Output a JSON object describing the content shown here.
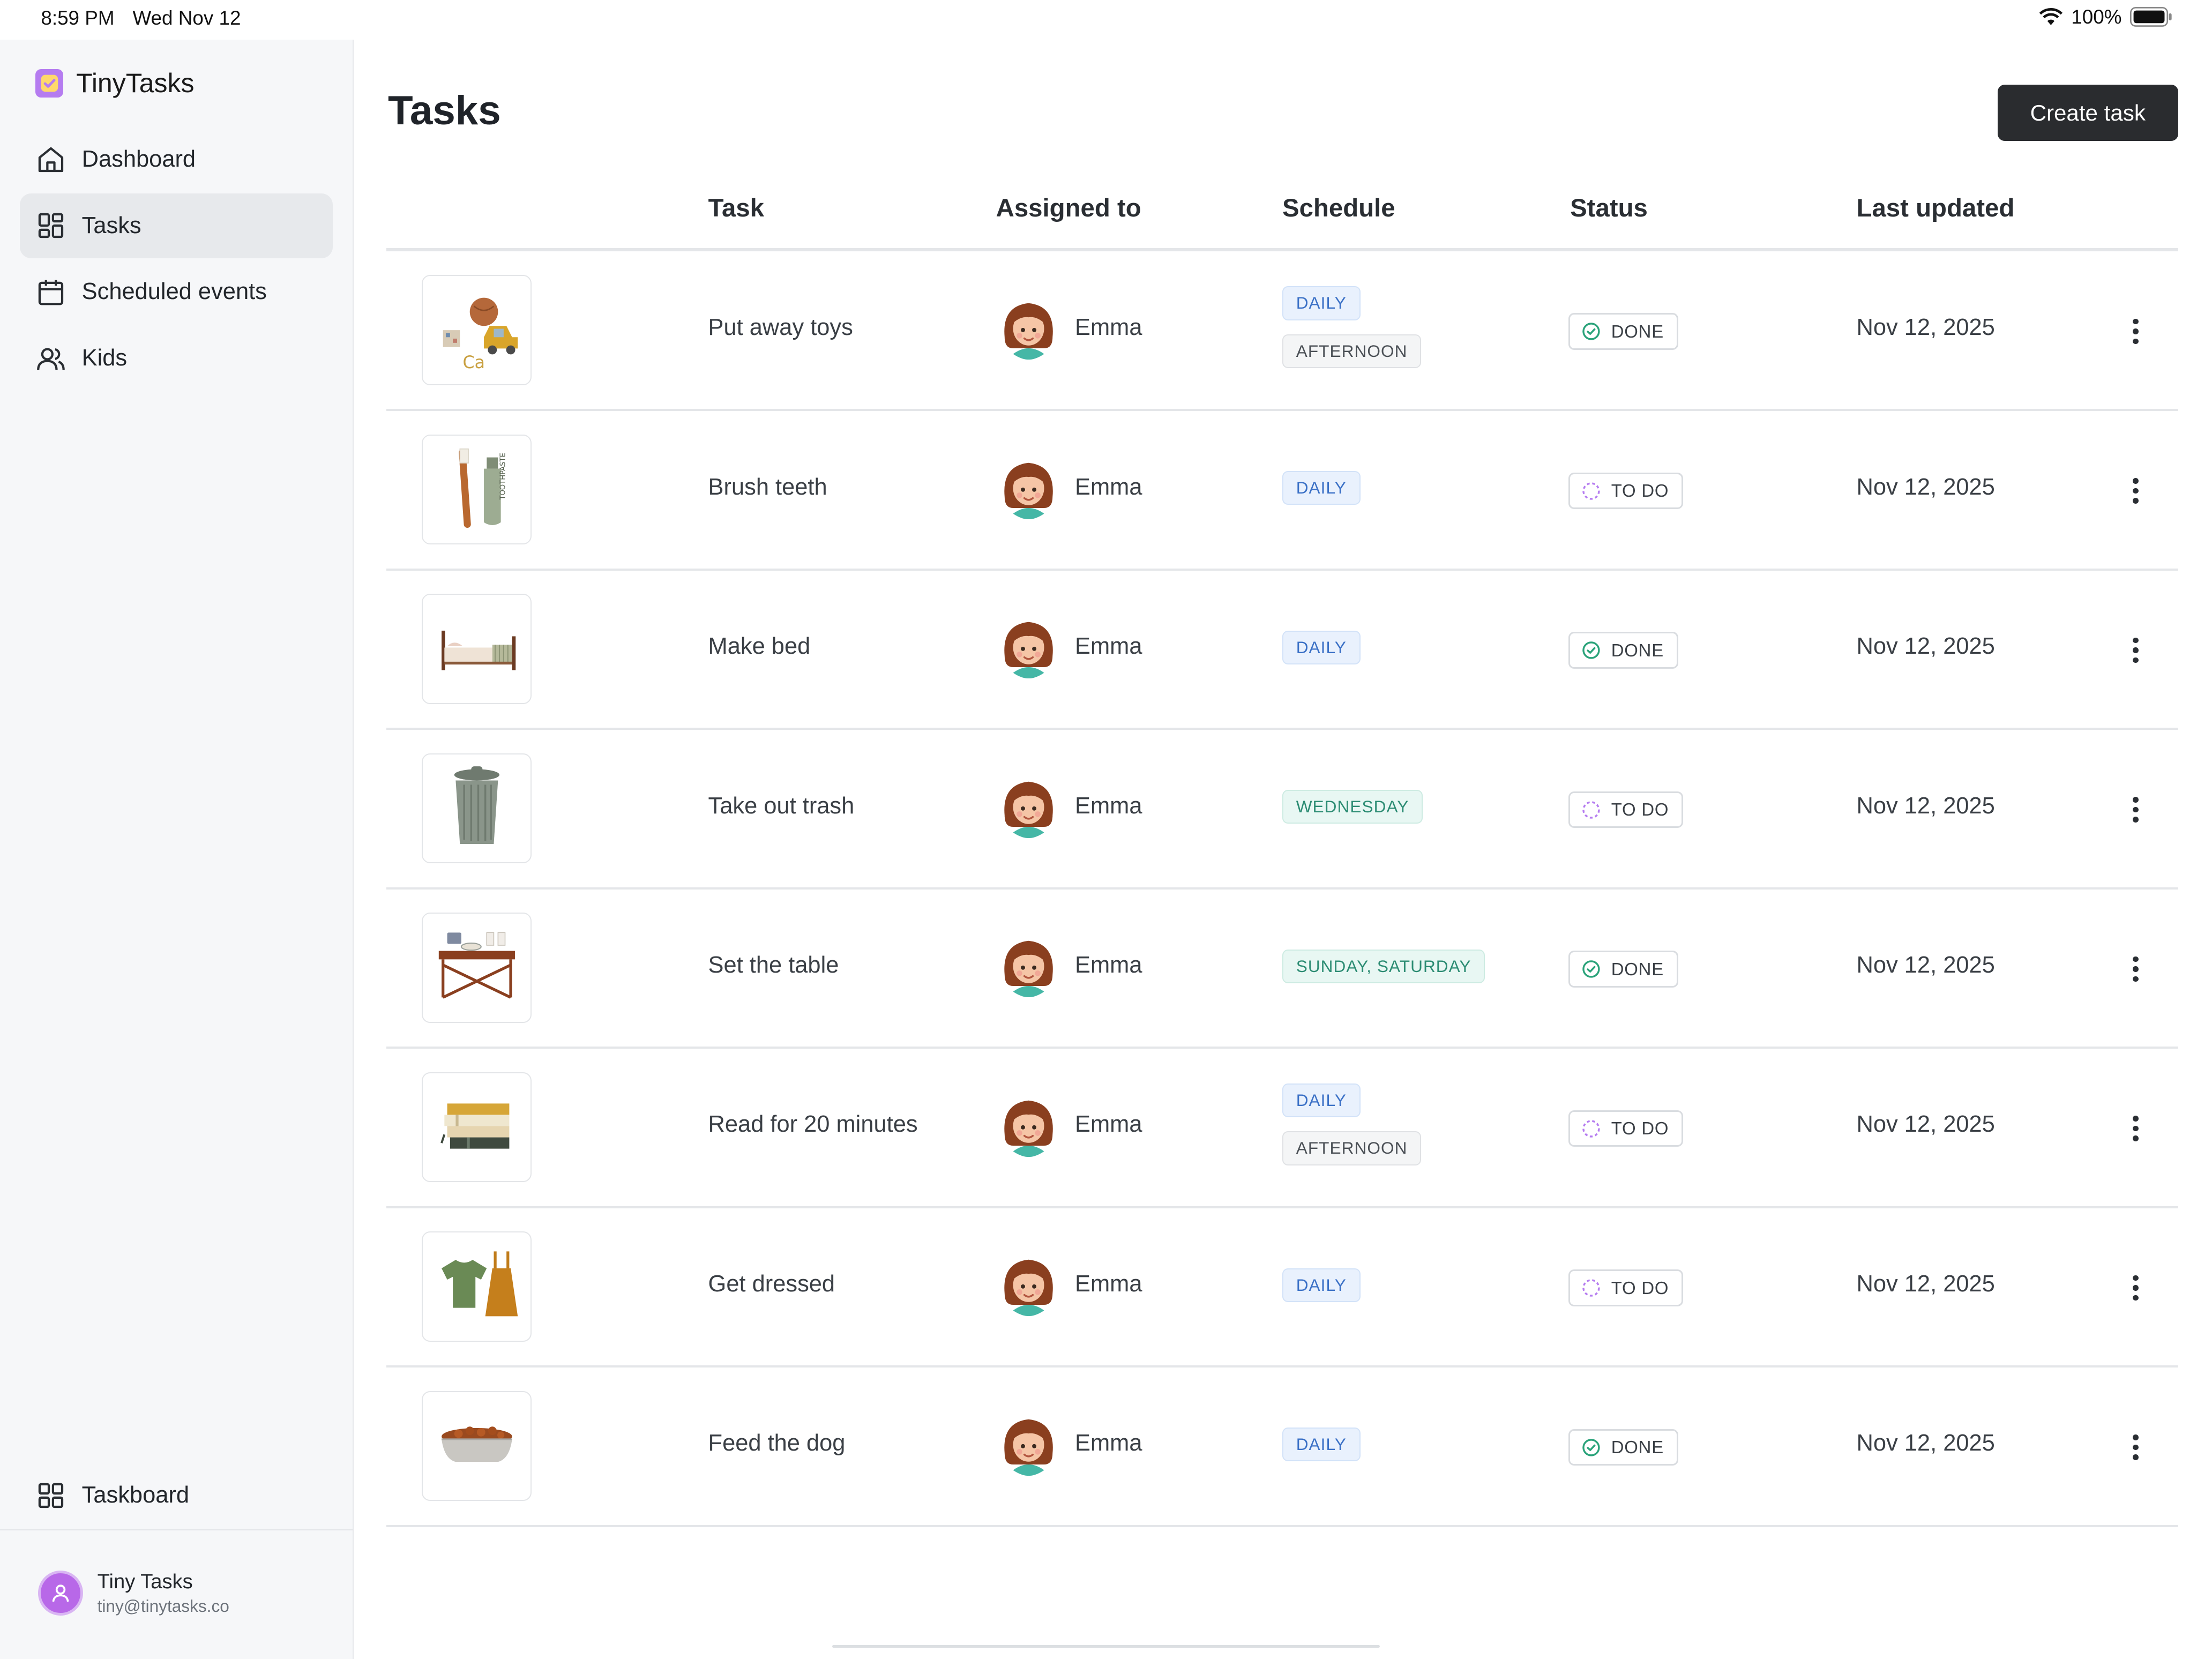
{
  "status_bar": {
    "time": "8:59 PM",
    "date": "Wed Nov 12",
    "battery": "100%"
  },
  "app": {
    "name": "TinyTasks"
  },
  "sidebar": {
    "items": [
      {
        "label": "Dashboard",
        "icon": "home-icon"
      },
      {
        "label": "Tasks",
        "icon": "grid-icon",
        "active": true
      },
      {
        "label": "Scheduled events",
        "icon": "calendar-icon"
      },
      {
        "label": "Kids",
        "icon": "users-icon"
      }
    ],
    "taskboard": "Taskboard",
    "user": {
      "name": "Tiny Tasks",
      "email": "tiny@tinytasks.co"
    }
  },
  "page": {
    "title": "Tasks",
    "create_button": "Create task"
  },
  "table": {
    "columns": [
      "Task",
      "Assigned to",
      "Schedule",
      "Status",
      "Last updated"
    ],
    "rows": [
      {
        "task": "Put away toys",
        "assignee": "Emma",
        "schedule": [
          "DAILY",
          "AFTERNOON"
        ],
        "status": "DONE",
        "updated": "Nov 12, 2025",
        "icon": "toys-icon"
      },
      {
        "task": "Brush teeth",
        "assignee": "Emma",
        "schedule": [
          "DAILY"
        ],
        "status": "TO DO",
        "updated": "Nov 12, 2025",
        "icon": "toothbrush-icon"
      },
      {
        "task": "Make bed",
        "assignee": "Emma",
        "schedule": [
          "DAILY"
        ],
        "status": "DONE",
        "updated": "Nov 12, 2025",
        "icon": "bed-icon"
      },
      {
        "task": "Take out trash",
        "assignee": "Emma",
        "schedule": [
          "WEDNESDAY"
        ],
        "status": "TO DO",
        "updated": "Nov 12, 2025",
        "icon": "trash-can-icon"
      },
      {
        "task": "Set the table",
        "assignee": "Emma",
        "schedule": [
          "SUNDAY, SATURDAY"
        ],
        "status": "DONE",
        "updated": "Nov 12, 2025",
        "icon": "table-icon"
      },
      {
        "task": "Read for 20 minutes",
        "assignee": "Emma",
        "schedule": [
          "DAILY",
          "AFTERNOON"
        ],
        "status": "TO DO",
        "updated": "Nov 12, 2025",
        "icon": "books-icon"
      },
      {
        "task": "Get dressed",
        "assignee": "Emma",
        "schedule": [
          "DAILY"
        ],
        "status": "TO DO",
        "updated": "Nov 12, 2025",
        "icon": "clothes-icon"
      },
      {
        "task": "Feed the dog",
        "assignee": "Emma",
        "schedule": [
          "DAILY"
        ],
        "status": "DONE",
        "updated": "Nov 12, 2025",
        "icon": "dog-bowl-icon"
      }
    ]
  }
}
